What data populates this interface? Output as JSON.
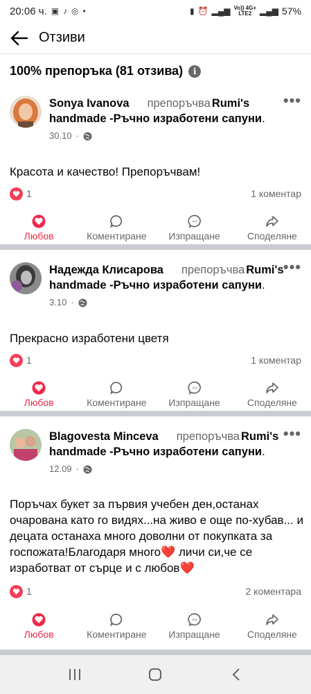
{
  "status_bar": {
    "time": "20:06 ч.",
    "battery": "57%",
    "network_top": "Vo)) 4G+",
    "network_bottom": "LTE2"
  },
  "header": {
    "title": "Отзиви"
  },
  "summary": {
    "text": "100% препоръка (81 отзива)"
  },
  "posts": [
    {
      "name": "Sonya Ivanova",
      "recommends": "препоръчва",
      "page": "Rumi's handmade -Ръчно изработени сапуни",
      "date": "30.10",
      "text": "Красота и качество! Препоръчвам!",
      "reactions": "1",
      "comments": "1 коментар"
    },
    {
      "name": "Надежда Клисарова",
      "recommends": "препоръчва",
      "page": "Rumi's handmade -Ръчно изработени сапуни",
      "date": "3.10",
      "text": "Прекрасно изработени цветя",
      "reactions": "1",
      "comments": "1 коментар"
    },
    {
      "name": "Blagovesta Minceva",
      "recommends": "препоръчва",
      "page": "Rumi's handmade -Ръчно изработени сапуни",
      "date": "12.09",
      "text": "Поръчах букет за първия учебен ден,останах очарована като го видях...на живо е още по-хубав... и децата останаха много доволни от покупката за госпожата!Благодаря много❤️ личи си,че се изработват от сърце и с любов❤️",
      "reactions": "1",
      "comments": "2 коментара"
    }
  ],
  "actions": {
    "love": "Любов",
    "comment": "Коментиране",
    "send": "Изпращане",
    "share": "Споделяне"
  },
  "colors": {
    "love_red": "#f02849",
    "heart_badge": "#f33e58",
    "muted": "#65676b",
    "separator": "#c9ccd1"
  }
}
